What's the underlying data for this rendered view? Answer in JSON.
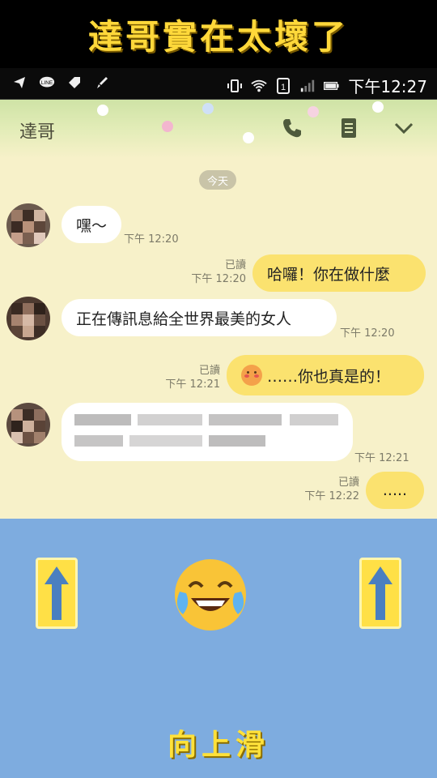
{
  "banner": {
    "title": "達哥實在太壞了"
  },
  "status_bar": {
    "time": "下午12:27",
    "left_icons": [
      "send-icon",
      "line-icon",
      "tag-icon",
      "brush-icon"
    ],
    "right_icons": [
      "vibrate-icon",
      "wifi-icon",
      "sim-icon",
      "signal-icon",
      "battery-icon"
    ]
  },
  "chat": {
    "contact_name": "達哥",
    "date_label": "今天",
    "messages": [
      {
        "side": "in",
        "text": "嘿～",
        "time": "下午 12:20"
      },
      {
        "side": "out",
        "text": "哈囉！你在做什麼",
        "read": "已讀",
        "time": "下午 12:20"
      },
      {
        "side": "in",
        "text": "正在傳訊息給全世界最美的女人",
        "time": "下午 12:20"
      },
      {
        "side": "out",
        "text": "……你也真是的！",
        "read": "已讀",
        "time": "下午 12:21"
      },
      {
        "side": "in",
        "text": "",
        "time": "下午 12:21"
      },
      {
        "side": "out",
        "text": ".....",
        "read": "已讀",
        "time": "下午 12:22"
      }
    ]
  },
  "footer": {
    "swipe_label": "向上滑"
  },
  "colors": {
    "accent": "#ffd83a",
    "chat_bg": "#f7f1c9",
    "out_bubble": "#fbe26f",
    "footer_bg": "#7eacdf"
  }
}
